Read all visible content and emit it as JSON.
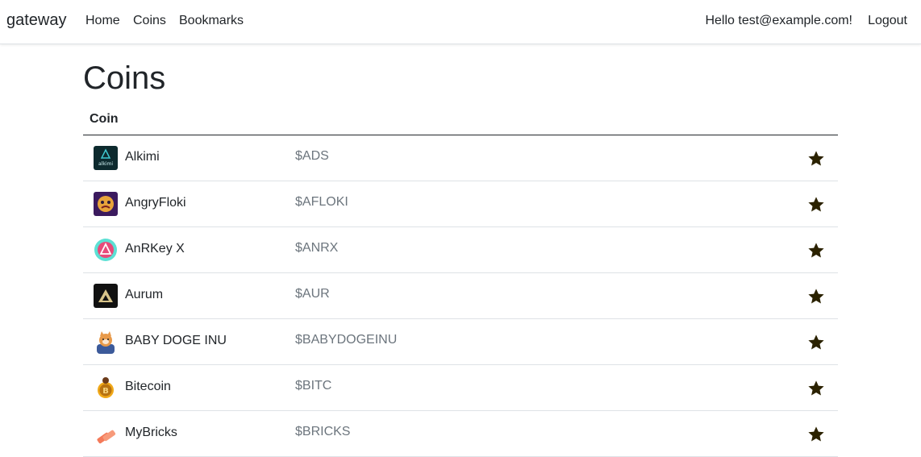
{
  "nav": {
    "brand": "gateway",
    "links": [
      "Home",
      "Coins",
      "Bookmarks"
    ],
    "greeting": "Hello test@example.com!",
    "logout": "Logout"
  },
  "page": {
    "title": "Coins"
  },
  "table": {
    "header": "Coin",
    "rows": [
      {
        "name": "Alkimi",
        "symbol": "$ADS",
        "logo": "alkimi-logo",
        "bookmarked": true
      },
      {
        "name": "AngryFloki",
        "symbol": "$AFLOKI",
        "logo": "angryfloki-logo",
        "bookmarked": true
      },
      {
        "name": "AnRKey X",
        "symbol": "$ANRX",
        "logo": "anrkey-logo",
        "bookmarked": true
      },
      {
        "name": "Aurum",
        "symbol": "$AUR",
        "logo": "aurum-logo",
        "bookmarked": true
      },
      {
        "name": "BABY DOGE INU",
        "symbol": "$BABYDOGEINU",
        "logo": "babydoge-logo",
        "bookmarked": true
      },
      {
        "name": "Bitecoin",
        "symbol": "$BITC",
        "logo": "bitecoin-logo",
        "bookmarked": true
      },
      {
        "name": "MyBricks",
        "symbol": "$BRICKS",
        "logo": "mybricks-logo",
        "bookmarked": true
      }
    ]
  },
  "colors": {
    "star": "#2b2200",
    "symbol_text": "#6c757d",
    "border": "#dee2e6"
  }
}
